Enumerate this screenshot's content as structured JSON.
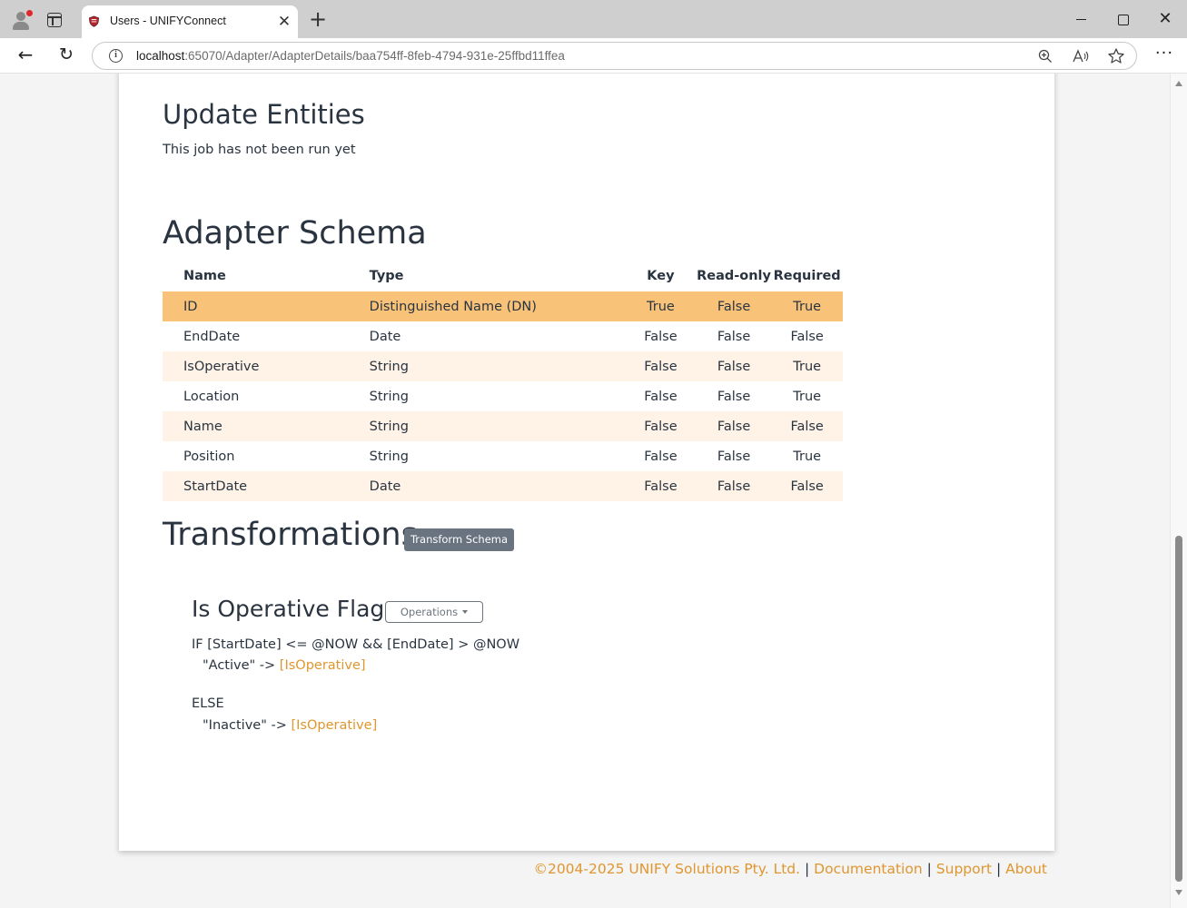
{
  "browser": {
    "tab_title": "Users - UNIFYConnect",
    "tab_close": "✕",
    "new_tab": "+",
    "url_host": "localhost",
    "url_rest": ":65070/Adapter/AdapterDetails/baa754ff-8feb-4794-931e-25ffbd11ffea",
    "window_close": "✕",
    "more": "···",
    "icons": {
      "profile": "profile-icon",
      "tab_actions": "tab-actions-icon",
      "favicon": "shield-favicon-icon",
      "back": "back-arrow-icon",
      "refresh": "refresh-icon",
      "site_info": "info-icon",
      "zoom": "zoom-in-icon",
      "read_aloud": "read-aloud-icon",
      "favorite": "star-icon"
    }
  },
  "update_entities": {
    "heading": "Update Entities",
    "status": "This job has not been run yet"
  },
  "adapter_schema": {
    "heading": "Adapter Schema",
    "columns": [
      "Name",
      "Type",
      "Key",
      "Read-only",
      "Required"
    ],
    "rows": [
      {
        "name": "ID",
        "type": "Distinguished Name (DN)",
        "key": "True",
        "readonly": "False",
        "required": "True"
      },
      {
        "name": "EndDate",
        "type": "Date",
        "key": "False",
        "readonly": "False",
        "required": "False"
      },
      {
        "name": "IsOperative",
        "type": "String",
        "key": "False",
        "readonly": "False",
        "required": "True"
      },
      {
        "name": "Location",
        "type": "String",
        "key": "False",
        "readonly": "False",
        "required": "True"
      },
      {
        "name": "Name",
        "type": "String",
        "key": "False",
        "readonly": "False",
        "required": "False"
      },
      {
        "name": "Position",
        "type": "String",
        "key": "False",
        "readonly": "False",
        "required": "True"
      },
      {
        "name": "StartDate",
        "type": "Date",
        "key": "False",
        "readonly": "False",
        "required": "False"
      }
    ],
    "highlight_color": "#f8c379",
    "alt_row_color": "#fef3e6"
  },
  "transformations": {
    "heading": "Transformations",
    "transform_button": "Transform Schema",
    "flag_heading": "Is Operative Flag",
    "operations_button": "Operations",
    "if_line": "IF [StartDate] <= @NOW && [EndDate] > @NOW",
    "then_value": "\"Active\" ->",
    "then_target": "[IsOperative]",
    "else_label": "ELSE",
    "else_value": "\"Inactive\" ->",
    "else_target": "[IsOperative]"
  },
  "footer": {
    "copyright": "©2004-2025 UNIFY Solutions Pty. Ltd.",
    "sep": "|",
    "documentation": "Documentation",
    "support": "Support",
    "about": "About",
    "accent_color": "#e0962f"
  }
}
